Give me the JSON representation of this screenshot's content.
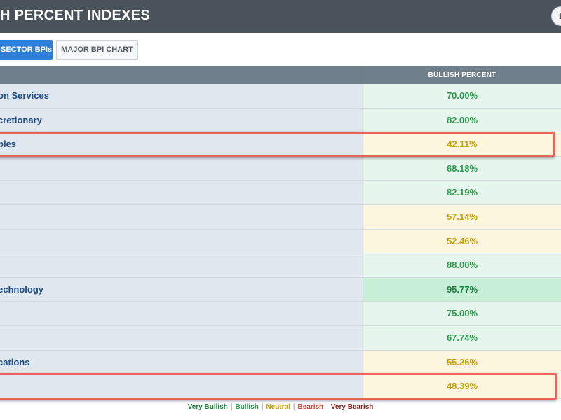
{
  "header": {
    "title": "H PERCENT INDEXES",
    "button_label": "I"
  },
  "tabs": [
    {
      "label": "SECTOR BPIs"
    },
    {
      "label": "MAJOR BPI CHART"
    }
  ],
  "table": {
    "column_header": "BULLISH PERCENT",
    "rows": [
      {
        "name": "on Services",
        "value": "70.00%",
        "status": "bullish"
      },
      {
        "name": "cretionary",
        "value": "82.00%",
        "status": "bullish"
      },
      {
        "name": "ples",
        "value": "42.11%",
        "status": "neutral"
      },
      {
        "name": "",
        "value": "68.18%",
        "status": "bullish"
      },
      {
        "name": "",
        "value": "82.19%",
        "status": "bullish"
      },
      {
        "name": "",
        "value": "57.14%",
        "status": "neutral"
      },
      {
        "name": "",
        "value": "52.46%",
        "status": "neutral"
      },
      {
        "name": "",
        "value": "88.00%",
        "status": "bullish"
      },
      {
        "name": "echnology",
        "value": "95.77%",
        "status": "very_bullish"
      },
      {
        "name": "",
        "value": "75.00%",
        "status": "bullish"
      },
      {
        "name": "",
        "value": "67.74%",
        "status": "bullish"
      },
      {
        "name": "cations",
        "value": "55.26%",
        "status": "neutral"
      },
      {
        "name": "",
        "value": "48.39%",
        "status": "neutral"
      }
    ]
  },
  "legend": {
    "very_bullish": "Very Bullish",
    "bullish": "Bullish",
    "neutral": "Neutral",
    "bearish": "Bearish",
    "very_bearish": "Very Bearish",
    "separator": "|"
  },
  "colors": {
    "header_bg": "#4a535c",
    "accent": "#2f7ed8",
    "name_text": "#1d4f87",
    "highlight_border": "#e8645a",
    "very_bullish_bg": "#c8efd7",
    "bullish_bg": "#e7f6ec",
    "neutral_bg": "#fdf6df",
    "very_bullish_text": "#1a7f3c",
    "bullish_text": "#2a9d4e",
    "neutral_text": "#c9a100",
    "bearish_text": "#d23b2e",
    "very_bearish_text": "#8c1d1d"
  }
}
